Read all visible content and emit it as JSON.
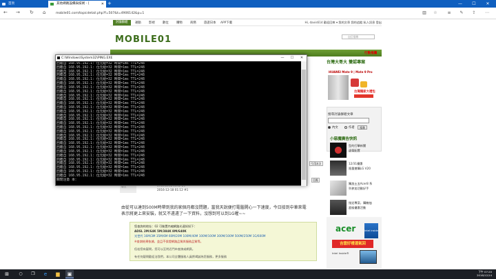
{
  "browser": {
    "tabs": [
      {
        "label": "首頁",
        "active": false
      },
      {
        "label": "其他網路設備與技術 - [",
        "active": true
      }
    ],
    "new_tab": "+",
    "window_controls": {
      "minimize": "—",
      "maximize": "☐",
      "close": "✕"
    },
    "url": "mobile01.com/topicdetail.php?f=507&t=4906142&p=1"
  },
  "site": {
    "top_nav": [
      "討論群組",
      "運動",
      "影視",
      "數位",
      "購物",
      "商務",
      "旅遊日本",
      "APP下載"
    ],
    "user_links": "Hi, davis614 歡迎回來 ▾   我的文章   我的追蹤   私人訊息   登出",
    "logo": "MOBILE01",
    "search_placeholder": "自訂搜尋",
    "activity_link": "行動推薦",
    "right_title": "台灣大哥大 雙認專案",
    "ad_brand": "HUAWEI Mate 9 | Mate 9 Pro",
    "ad_promo": "台灣獨家大禮包",
    "search_box_label": "搜尋討論群組文章",
    "radio_options": [
      "內文",
      "作者"
    ],
    "search_button": "搜尋",
    "event_title": "小惡魔廣告快訊",
    "events": [
      {
        "line1": "型的打擊新聞",
        "line2": "虛擬配置"
      },
      {
        "line1": "12/31優惠",
        "line2": "限量搶購LG V20"
      },
      {
        "line1": "獨加土五Acer8 系",
        "line2": "列參加活動好手"
      },
      {
        "line1": "指定專案，購機抽",
        "line2": "超級優惠活動"
      }
    ],
    "acer_logo": "acer",
    "intel_badge": "intel inside",
    "acer_promo": "吉雲好禮運氣回",
    "acer_note": "Intel Inside®"
  },
  "post": {
    "avatar_label": "版主",
    "meta_line1": "2016-12-18 01:12 #1",
    "meta_line2": "2016-12-18 01:12 #1",
    "reply_button": "回應",
    "quote_button": "引用本文",
    "body_line1": "由從可以達到500M時帶到我的家個月都沒問題，當我天說便打電腦開心一下速度，今日接到中華來電",
    "body_line2": "表示將更上來安裝，就又不遠遠了一下資料，沒想到可以到1G喔~~",
    "info_lines": [
      "您查詢的地址：02            可裝置內縮網路光速如如下：",
      "ADSL  2M/64K   5M/384K   8M/640K",
      "光世代   16M/3M   35M/6M   60M/20M   100M/40M   100M/100M   300M/100M   500M/250M   1G/600M",
      "※查詢結果依據，並且不保證網路品質與服務品質等。",
      "但若您有疑問，您可以至附近門市查詢或網頁。",
      "有任何疑問歡迎洽我們，本公司全體服務人員將竭誠為您服務，更多服務"
    ]
  },
  "cmd": {
    "title": "C:\\Windows\\System32\\PING.EXE",
    "reply_line": "回覆自 168.95.192.1: 位元組=32 時間=1ms TTL=248",
    "footer": "關閉注意 本："
  },
  "taskbar": {
    "time": "下午 07:20",
    "date": "2016/12/14"
  }
}
